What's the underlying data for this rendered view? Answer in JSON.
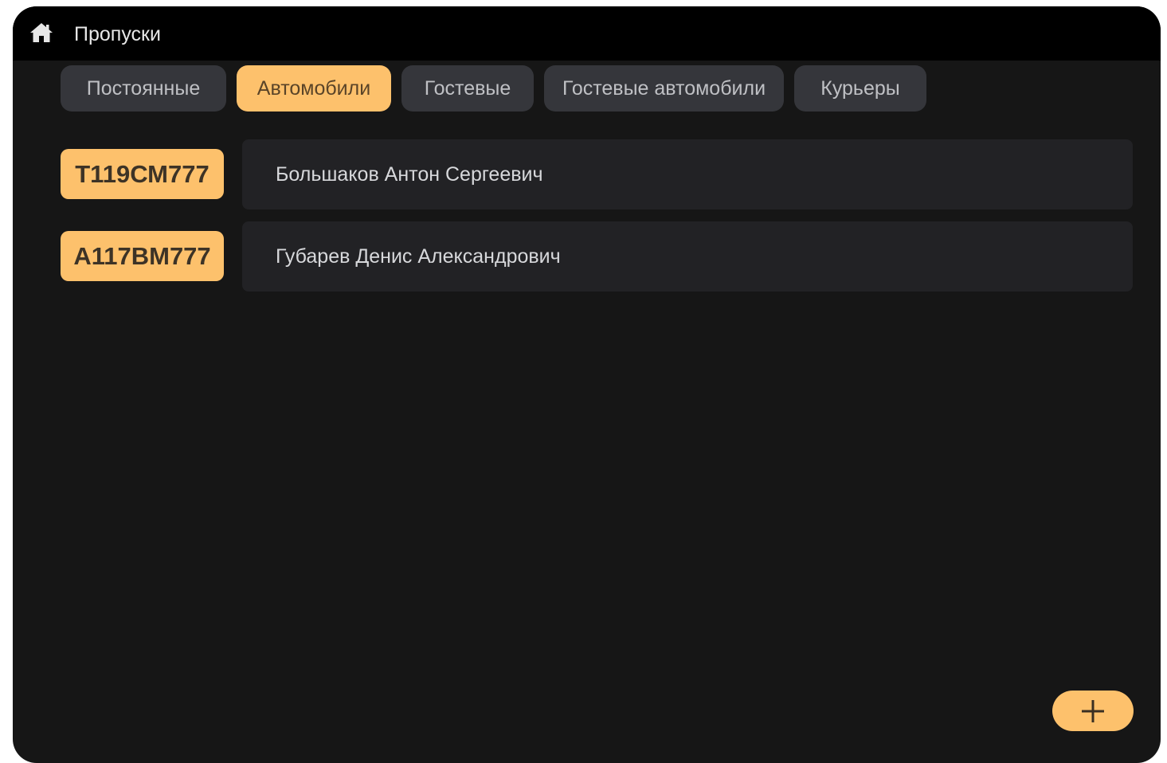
{
  "header": {
    "title": "Пропуски",
    "home_icon": "home-icon"
  },
  "tabs": [
    {
      "label": "Постоянные",
      "active": false
    },
    {
      "label": "Автомобили",
      "active": true
    },
    {
      "label": "Гостевые",
      "active": false
    },
    {
      "label": "Гостевые автомобили",
      "active": false
    },
    {
      "label": "Курьеры",
      "active": false
    }
  ],
  "passes": [
    {
      "plate": "Т119СМ777",
      "name": "Большаков Антон Сергеевич"
    },
    {
      "plate": "А117ВМ777",
      "name": "Губарев Денис Александрович"
    }
  ],
  "add_button": {
    "icon": "plus-icon"
  },
  "colors": {
    "accent": "#fdc16c",
    "background": "#161616",
    "header": "#000000",
    "tab_inactive": "#35363b",
    "card": "#222225"
  }
}
